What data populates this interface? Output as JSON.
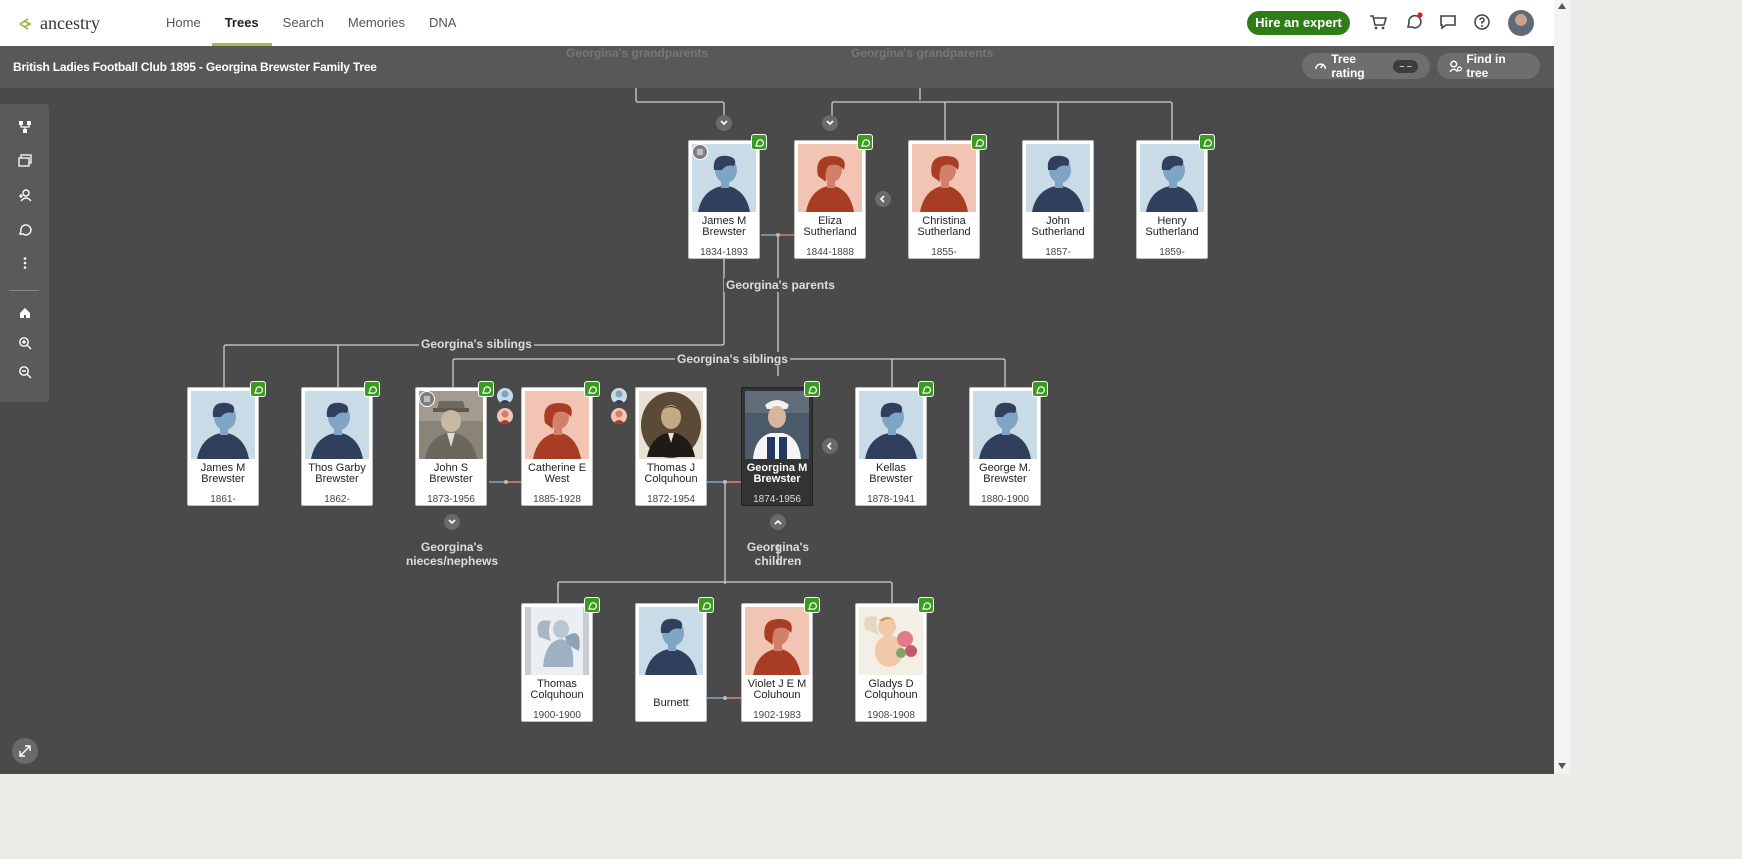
{
  "app": {
    "brand": "ancestry"
  },
  "nav": {
    "items": [
      {
        "label": "Home",
        "active": false
      },
      {
        "label": "Trees",
        "active": true
      },
      {
        "label": "Search",
        "active": false
      },
      {
        "label": "Memories",
        "active": false
      },
      {
        "label": "DNA",
        "active": false
      }
    ],
    "hire_label": "Hire an expert",
    "icons": [
      "cart-icon",
      "hints-icon",
      "messages-icon",
      "help-icon"
    ]
  },
  "tree": {
    "title": "British Ladies Football Club 1895 - Georgina Brewster Family Tree",
    "rating_label": "Tree rating",
    "rating_value": "– –",
    "find_label": "Find in tree"
  },
  "toolbar": {
    "tools": [
      "tree-view-icon",
      "gallery-icon",
      "add-person-icon",
      "hints-tool-icon",
      "more-icon",
      "home-icon",
      "zoom-in-icon",
      "zoom-out-icon"
    ]
  },
  "labels": {
    "grandparents_left": "Georgina's grandparents",
    "grandparents_right": "Georgina's grandparents",
    "parents": "Georgina's parents",
    "siblings_left": "Georgina's siblings",
    "siblings_right": "Georgina's siblings",
    "nieces_line1": "Georgina's",
    "nieces_line2": "nieces/nephews",
    "children_line1": "Georgina's",
    "children_line2": "children"
  },
  "people": {
    "james_m_sr": {
      "name": "James M Brewster",
      "dates": "1834-1893"
    },
    "eliza": {
      "name": "Eliza Sutherland",
      "dates": "1844-1888"
    },
    "christina": {
      "name": "Christina Sutherland",
      "dates": "1855-"
    },
    "john_s_1857": {
      "name": "John Sutherland",
      "dates": "1857-"
    },
    "henry": {
      "name": "Henry Sutherland",
      "dates": "1859-"
    },
    "james_m_jr": {
      "name": "James M Brewster",
      "dates": "1861-"
    },
    "thos": {
      "name": "Thos Garby Brewster",
      "dates": "1862-"
    },
    "john_s_brewster": {
      "name": "John S Brewster",
      "dates": "1873-1956"
    },
    "catherine": {
      "name": "Catherine E West",
      "dates": "1885-1928"
    },
    "thomas_j": {
      "name": "Thomas J Colquhoun",
      "dates": "1872-1954"
    },
    "georgina": {
      "name": "Georgina M Brewster",
      "dates": "1874-1956"
    },
    "kellas": {
      "name": "Kellas Brewster",
      "dates": "1878-1941"
    },
    "george_m": {
      "name": "George M. Brewster",
      "dates": "1880-1900"
    },
    "thomas_c": {
      "name": "Thomas Colquhoun",
      "dates": "1900-1900"
    },
    "burnett": {
      "name": "Burnett",
      "dates": ""
    },
    "violet": {
      "name": "Violet J E M Coluhoun",
      "dates": "1902-1983"
    },
    "gladys": {
      "name": "Gladys D Colquhoun",
      "dates": "1908-1908"
    }
  },
  "colors": {
    "canvas_bg": "#4a4a4a",
    "male_photo_bg": "#c9dbe6",
    "female_photo_bg": "#f1c4b3",
    "hint_green": "#3a9b20",
    "brand_green": "#2e7d17",
    "male_line": "#7ea6c4",
    "female_line": "#d2806a"
  }
}
